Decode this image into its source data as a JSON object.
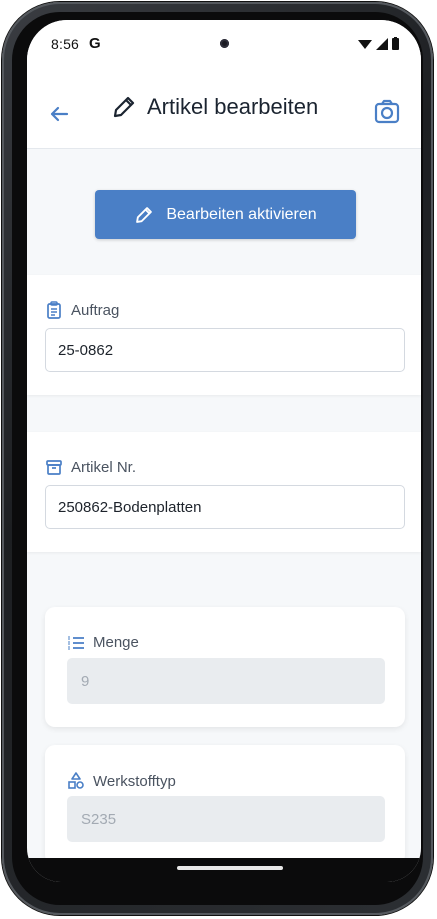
{
  "status_bar": {
    "time": "8:56",
    "g_label": "G"
  },
  "app_bar": {
    "title": "Artikel bearbeiten",
    "icons": [
      "arrow-left-icon",
      "pencil-icon",
      "camera-icon"
    ]
  },
  "actions": {
    "activate_label": "Bearbeiten aktivieren"
  },
  "fields": {
    "auftrag": {
      "label": "Auftrag",
      "value": "25-0862",
      "icon": "clipboard-icon"
    },
    "artikel_nr": {
      "label": "Artikel Nr.",
      "value": "250862-Bodenplatten",
      "icon": "archive-box-icon"
    },
    "menge": {
      "label": "Menge",
      "value": "9",
      "icon": "list-icon"
    },
    "werkstofftyp": {
      "label": "Werkstofftyp",
      "value": "S235",
      "icon": "shapes-icon"
    }
  },
  "colors": {
    "primary": "#4a7fc6",
    "background": "#f6f8fa",
    "disabled_field": "#e9ecef"
  }
}
